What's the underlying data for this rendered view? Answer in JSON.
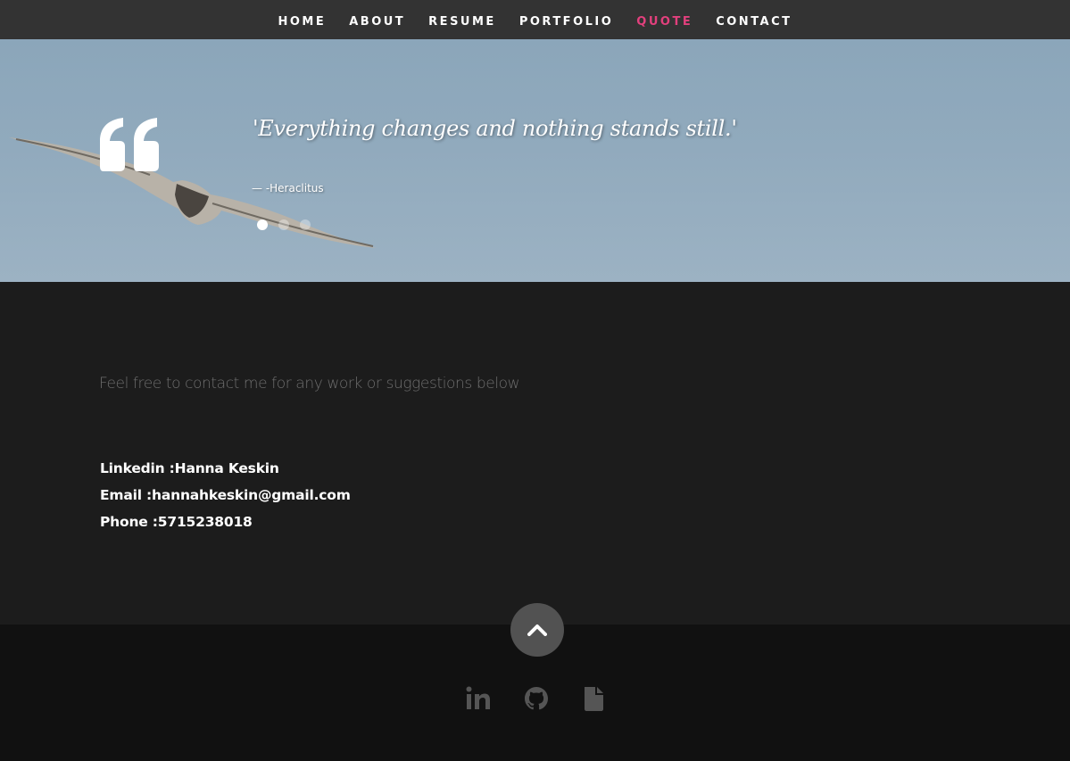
{
  "nav": {
    "items": [
      {
        "label": "HOME",
        "active": false
      },
      {
        "label": "ABOUT",
        "active": false
      },
      {
        "label": "RESUME",
        "active": false
      },
      {
        "label": "PORTFOLIO",
        "active": false
      },
      {
        "label": "QUOTE",
        "active": true
      },
      {
        "label": "CONTACT",
        "active": false
      }
    ],
    "active_color": "#e2407d"
  },
  "quote": {
    "text": "'Everything changes and nothing stands still.'",
    "author": "— -Heraclitus",
    "slides": 3,
    "active_slide": 1,
    "icon": "quote-icon"
  },
  "contact": {
    "intro": "Feel free to contact me for any work or suggestions below",
    "lines": [
      "Linkedin :Hanna Keskin",
      "Email :hannahkeskin@gmail.com",
      "Phone :5715238018"
    ]
  },
  "footer": {
    "back_to_top_icon": "chevron-up-icon",
    "socials": [
      "linkedin-icon",
      "github-icon",
      "document-icon"
    ],
    "icon_color": "#555555"
  }
}
